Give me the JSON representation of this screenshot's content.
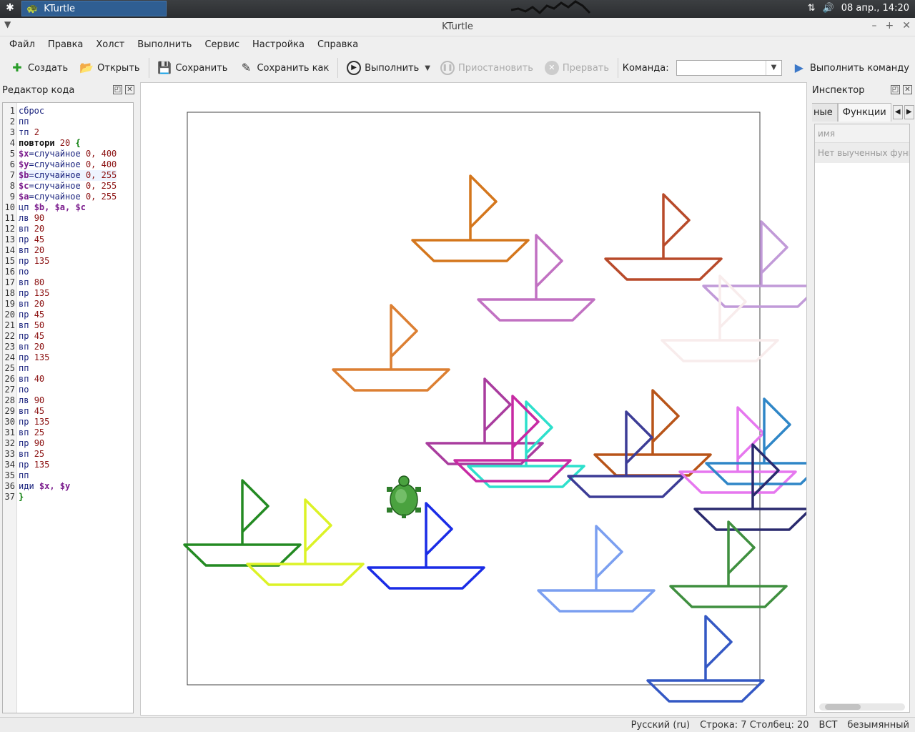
{
  "panel": {
    "task_title": "KTurtle",
    "date_time": "08 апр., 14:20"
  },
  "window": {
    "title": "KTurtle"
  },
  "menu": [
    "Файл",
    "Правка",
    "Холст",
    "Выполнить",
    "Сервис",
    "Настройка",
    "Справка"
  ],
  "toolbar": {
    "new": "Создать",
    "open": "Открыть",
    "save": "Сохранить",
    "save_as": "Сохранить как",
    "run": "Выполнить",
    "pause": "Приостановить",
    "abort": "Прервать",
    "command_label": "Команда:",
    "run_command": "Выполнить команду"
  },
  "editor": {
    "title": "Редактор кода",
    "lines": [
      [
        {
          "t": "сброс",
          "c": "fn"
        }
      ],
      [
        {
          "t": "пп",
          "c": "fn"
        }
      ],
      [
        {
          "t": "тп ",
          "c": "fn"
        },
        {
          "t": "2",
          "c": "num"
        }
      ],
      [
        {
          "t": "повтори ",
          "c": "kw"
        },
        {
          "t": "20",
          "c": "num"
        },
        {
          "t": " {",
          "c": "br"
        }
      ],
      [
        {
          "t": "$x",
          "c": "var"
        },
        {
          "t": "=случайное ",
          "c": "fn"
        },
        {
          "t": "0, 400",
          "c": "num"
        }
      ],
      [
        {
          "t": "$y",
          "c": "var"
        },
        {
          "t": "=случайное ",
          "c": "fn"
        },
        {
          "t": "0, 400",
          "c": "num"
        }
      ],
      [
        {
          "t": "$b",
          "c": "var"
        },
        {
          "t": "=случайное ",
          "c": "fn"
        },
        {
          "t": "0, 255",
          "c": "num"
        }
      ],
      [
        {
          "t": "$c",
          "c": "var"
        },
        {
          "t": "=случайное ",
          "c": "fn"
        },
        {
          "t": "0, 255",
          "c": "num"
        }
      ],
      [
        {
          "t": "$a",
          "c": "var"
        },
        {
          "t": "=случайное ",
          "c": "fn"
        },
        {
          "t": "0, 255",
          "c": "num"
        }
      ],
      [
        {
          "t": "цп ",
          "c": "fn"
        },
        {
          "t": "$b, $a, $c",
          "c": "var"
        }
      ],
      [
        {
          "t": "лв ",
          "c": "fn"
        },
        {
          "t": "90",
          "c": "num"
        }
      ],
      [
        {
          "t": "вп ",
          "c": "fn"
        },
        {
          "t": "20",
          "c": "num"
        }
      ],
      [
        {
          "t": "пр ",
          "c": "fn"
        },
        {
          "t": "45",
          "c": "num"
        }
      ],
      [
        {
          "t": "вп ",
          "c": "fn"
        },
        {
          "t": "20",
          "c": "num"
        }
      ],
      [
        {
          "t": "пр ",
          "c": "fn"
        },
        {
          "t": "135",
          "c": "num"
        }
      ],
      [
        {
          "t": "по",
          "c": "fn"
        }
      ],
      [
        {
          "t": "вп ",
          "c": "fn"
        },
        {
          "t": "80",
          "c": "num"
        }
      ],
      [
        {
          "t": "пр ",
          "c": "fn"
        },
        {
          "t": "135",
          "c": "num"
        }
      ],
      [
        {
          "t": "вп ",
          "c": "fn"
        },
        {
          "t": "20",
          "c": "num"
        }
      ],
      [
        {
          "t": "пр ",
          "c": "fn"
        },
        {
          "t": "45",
          "c": "num"
        }
      ],
      [
        {
          "t": "вп ",
          "c": "fn"
        },
        {
          "t": "50",
          "c": "num"
        }
      ],
      [
        {
          "t": "пр ",
          "c": "fn"
        },
        {
          "t": "45",
          "c": "num"
        }
      ],
      [
        {
          "t": "вп ",
          "c": "fn"
        },
        {
          "t": "20",
          "c": "num"
        }
      ],
      [
        {
          "t": "пр ",
          "c": "fn"
        },
        {
          "t": "135",
          "c": "num"
        }
      ],
      [
        {
          "t": "пп",
          "c": "fn"
        }
      ],
      [
        {
          "t": "вп ",
          "c": "fn"
        },
        {
          "t": "40",
          "c": "num"
        }
      ],
      [
        {
          "t": "по",
          "c": "fn"
        }
      ],
      [
        {
          "t": "лв ",
          "c": "fn"
        },
        {
          "t": "90",
          "c": "num"
        }
      ],
      [
        {
          "t": "вп ",
          "c": "fn"
        },
        {
          "t": "45",
          "c": "num"
        }
      ],
      [
        {
          "t": "пр ",
          "c": "fn"
        },
        {
          "t": "135",
          "c": "num"
        }
      ],
      [
        {
          "t": "вп ",
          "c": "fn"
        },
        {
          "t": "25",
          "c": "num"
        }
      ],
      [
        {
          "t": "пр ",
          "c": "fn"
        },
        {
          "t": "90",
          "c": "num"
        }
      ],
      [
        {
          "t": "вп ",
          "c": "fn"
        },
        {
          "t": "25",
          "c": "num"
        }
      ],
      [
        {
          "t": "пр ",
          "c": "fn"
        },
        {
          "t": "135",
          "c": "num"
        }
      ],
      [
        {
          "t": "пп",
          "c": "fn"
        }
      ],
      [
        {
          "t": "иди ",
          "c": "fn"
        },
        {
          "t": "$x, $y",
          "c": "var"
        }
      ],
      [
        {
          "t": "}",
          "c": "br"
        }
      ]
    ],
    "current_line": 7
  },
  "inspector": {
    "title": "Инспектор",
    "tab_partial": "ные",
    "tab_active": "Функции",
    "column_header": "имя",
    "empty_text": "Нет выученных функций"
  },
  "boats": [
    {
      "color": "#d4761c"
    },
    {
      "color": "#b84a2a"
    },
    {
      "color": "#c171c2"
    },
    {
      "color": "#c19ad8"
    },
    {
      "color": "#f8ecec"
    },
    {
      "color": "#dc7f32"
    },
    {
      "color": "#a93c9e"
    },
    {
      "color": "#2de0cc"
    },
    {
      "color": "#c72aa3"
    },
    {
      "color": "#b85418"
    },
    {
      "color": "#3c3c96"
    },
    {
      "color": "#e677ef"
    },
    {
      "color": "#2f86c7"
    },
    {
      "color": "#2a2a6e"
    },
    {
      "color": "#238a22"
    },
    {
      "color": "#dcf226"
    },
    {
      "color": "#1a2ce6"
    },
    {
      "color": "#7b9ff0"
    },
    {
      "color": "#3f8f3f"
    },
    {
      "color": "#3458c4"
    }
  ],
  "status": {
    "language": "Русский (ru)",
    "position": "Строка: 7 Столбец: 20",
    "mode": "ВСТ",
    "file": "безымянный"
  }
}
